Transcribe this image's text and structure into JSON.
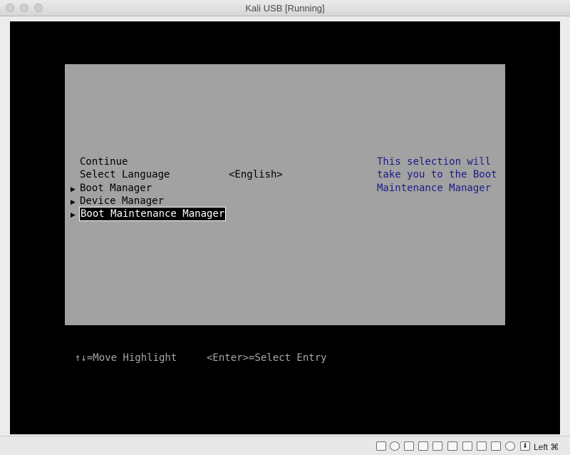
{
  "window": {
    "title": "Kali USB [Running]"
  },
  "menu": {
    "items": [
      {
        "label": "Continue",
        "submenu": false
      },
      {
        "label": "Select Language",
        "submenu": false,
        "value": "<English>"
      },
      {
        "label": "Boot Manager",
        "submenu": true
      },
      {
        "label": "Device Manager",
        "submenu": true
      },
      {
        "label": "Boot Maintenance Manager",
        "submenu": true,
        "selected": true
      }
    ],
    "help_lines": [
      "This selection will",
      "take you to the Boot",
      "Maintenance Manager"
    ]
  },
  "footer": {
    "move_hint": "↑↓=Move Highlight",
    "select_hint": "<Enter>=Select Entry"
  },
  "statusbar": {
    "icons": [
      "hard-disk-icon",
      "optical-drive-icon",
      "audio-icon",
      "network-icon",
      "usb-icon",
      "shared-folders-icon",
      "display-icon",
      "video-capture-icon",
      "cpu-icon",
      "mouse-integration-icon",
      "arrow-down-icon"
    ],
    "host_key": "Left ⌘"
  }
}
